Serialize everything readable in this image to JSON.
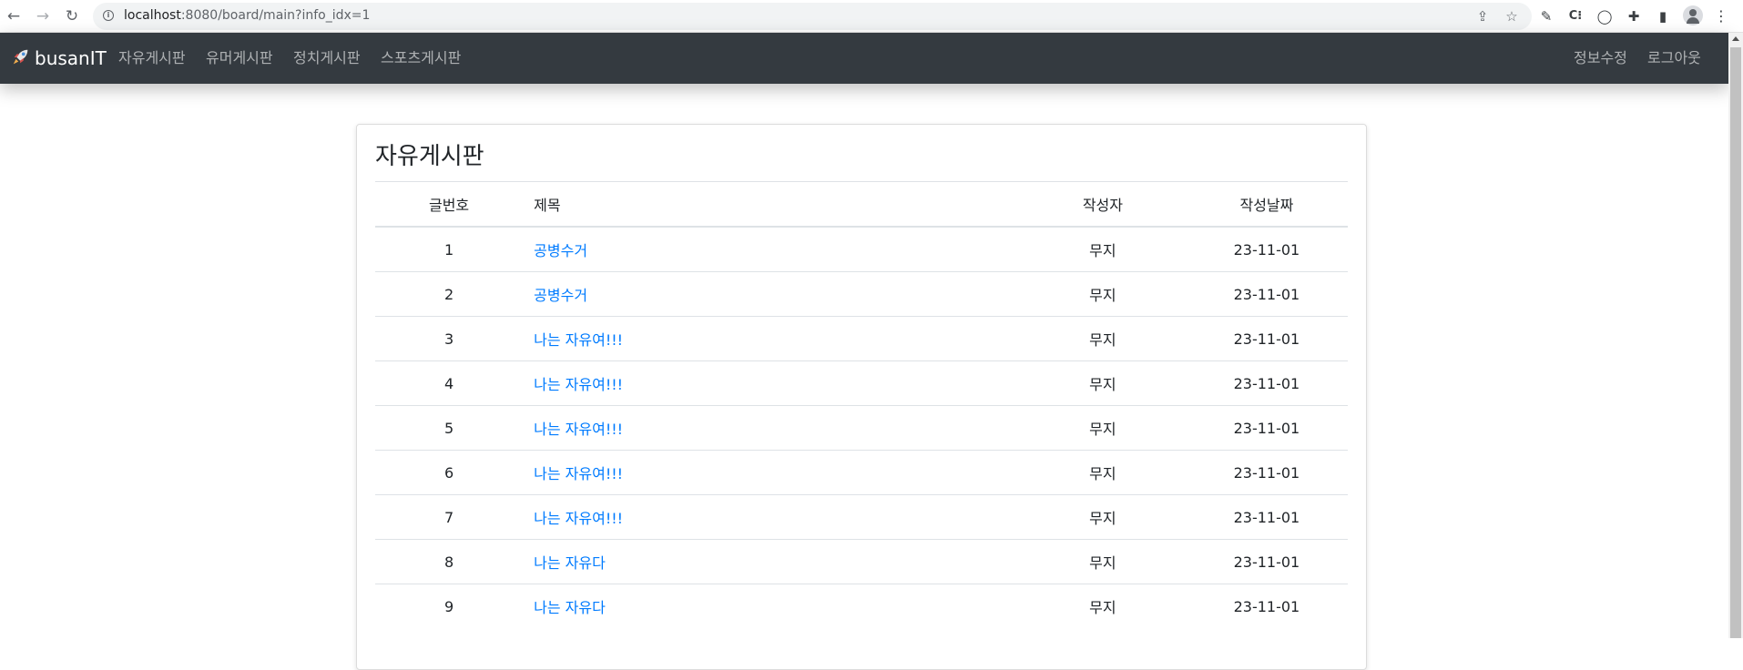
{
  "browser": {
    "url_host": "localhost",
    "url_rest": ":8080/board/main?info_idx=1"
  },
  "navbar": {
    "brand": "busanIT",
    "menu": [
      {
        "label": "자유게시판"
      },
      {
        "label": "유머게시판"
      },
      {
        "label": "정치게시판"
      },
      {
        "label": "스포츠게시판"
      }
    ],
    "right": [
      {
        "label": "정보수정"
      },
      {
        "label": "로그아웃"
      }
    ]
  },
  "board": {
    "title": "자유게시판",
    "columns": {
      "no": "글번호",
      "title": "제목",
      "writer": "작성자",
      "date": "작성날짜"
    },
    "rows": [
      {
        "no": "1",
        "title": "공병수거",
        "writer": "무지",
        "date": "23-11-01"
      },
      {
        "no": "2",
        "title": "공병수거",
        "writer": "무지",
        "date": "23-11-01"
      },
      {
        "no": "3",
        "title": "나는 자유여!!!",
        "writer": "무지",
        "date": "23-11-01"
      },
      {
        "no": "4",
        "title": "나는 자유여!!!",
        "writer": "무지",
        "date": "23-11-01"
      },
      {
        "no": "5",
        "title": "나는 자유여!!!",
        "writer": "무지",
        "date": "23-11-01"
      },
      {
        "no": "6",
        "title": "나는 자유여!!!",
        "writer": "무지",
        "date": "23-11-01"
      },
      {
        "no": "7",
        "title": "나는 자유여!!!",
        "writer": "무지",
        "date": "23-11-01"
      },
      {
        "no": "8",
        "title": "나는 자유다",
        "writer": "무지",
        "date": "23-11-01"
      },
      {
        "no": "9",
        "title": "나는 자유다",
        "writer": "무지",
        "date": "23-11-01"
      }
    ]
  }
}
